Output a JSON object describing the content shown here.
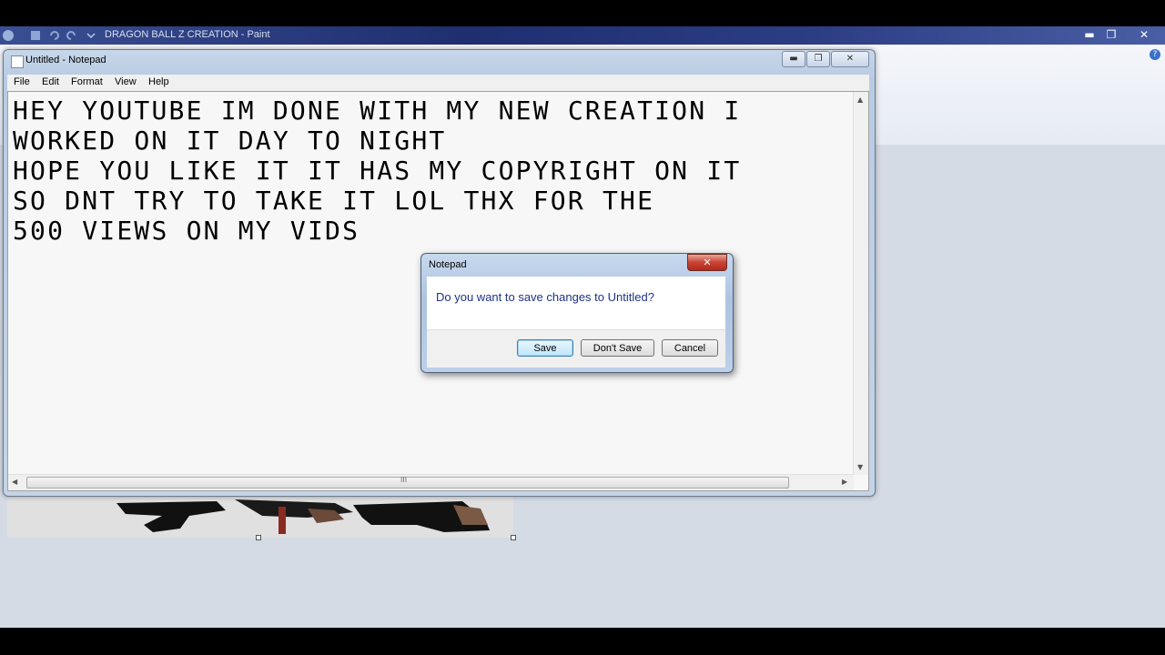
{
  "paint": {
    "title": "DRAGON BALL Z CREATION - Paint",
    "controls": {
      "minimize": "▬",
      "maximize": "❐",
      "close": "✕"
    },
    "help": "?"
  },
  "notepad": {
    "title": "Untitled - Notepad",
    "menu": [
      "File",
      "Edit",
      "Format",
      "View",
      "Help"
    ],
    "text": "HEY YOUTUBE IM DONE WITH MY NEW CREATION I\nWORKED ON IT DAY TO NIGHT\nHOPE YOU LIKE IT IT HAS MY COPYRIGHT ON IT\nSO DNT TRY TO TAKE IT LOL THX FOR THE\n500 VIEWS ON MY VIDS",
    "controls": {
      "minimize": "▬",
      "maximize": "❐",
      "close": "✕"
    },
    "scroll_grip": "III"
  },
  "dialog": {
    "title": "Notepad",
    "close": "✕",
    "message": "Do you want to save changes to Untitled?",
    "buttons": {
      "save": "Save",
      "dont_save": "Don't Save",
      "cancel": "Cancel"
    }
  }
}
